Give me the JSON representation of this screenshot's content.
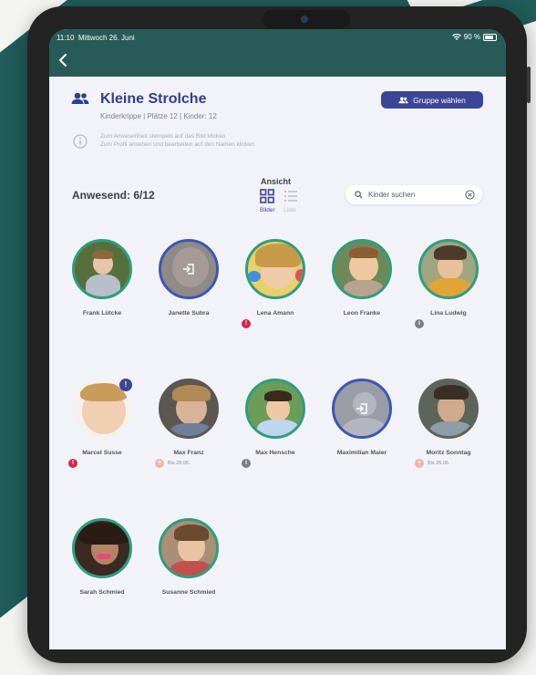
{
  "status": {
    "time": "11:10",
    "date": "Mittwoch 26. Juni",
    "battery": "90 %"
  },
  "group": {
    "title": "Kleine Strolche",
    "subtitle": "Kinderkrippe  |  Plätze 12  |  Kinder: 12",
    "select_button": "Gruppe wählen"
  },
  "hint": {
    "line1": "Zum Anwesenheit stempeln auf das Bild klicken",
    "line2": "Zum Profil ansehen und bearbeiten auf den Namen klicken"
  },
  "present_label": "Anwesend: 6/12",
  "view": {
    "label": "Ansicht",
    "bilder": "Bilder",
    "liste": "Liste"
  },
  "search": {
    "placeholder": "Kinder suchen"
  },
  "children": [
    {
      "name": "Frank Lütcke",
      "status": "present"
    },
    {
      "name": "Janette Subra",
      "status": "absent"
    },
    {
      "name": "Lena Amann",
      "status": "present",
      "badge": "!"
    },
    {
      "name": "Leon Franke",
      "status": "present"
    },
    {
      "name": "Lina Ludwig",
      "status": "present",
      "badge": "i"
    },
    {
      "name": "Marcel Susse",
      "status": "present",
      "badge": "!",
      "top_badge": "!"
    },
    {
      "name": "Max Franz",
      "status": "absent",
      "badge": "sick",
      "until": "Bis 28.06."
    },
    {
      "name": "Max Hensche",
      "status": "present",
      "badge": "i"
    },
    {
      "name": "Maximilian Maier",
      "status": "absent"
    },
    {
      "name": "Moritz Sonntag",
      "status": "absent",
      "badge": "sick",
      "until": "Bis 26.06."
    },
    {
      "name": "Sarah Schmied",
      "status": "present"
    },
    {
      "name": "Susanne Schmied",
      "status": "present"
    }
  ],
  "colors": {
    "topbar": "#285a57",
    "accent": "#3c4596",
    "present_ring": "#2f9e7e",
    "absent_ring": "#3b58b3",
    "alert": "#d82349"
  }
}
